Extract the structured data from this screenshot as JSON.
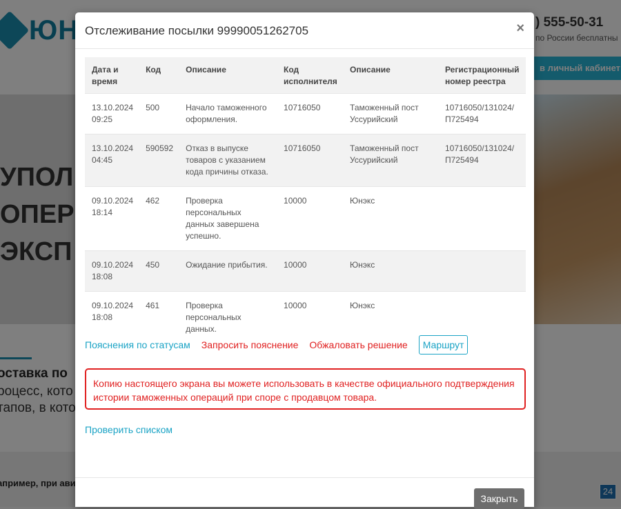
{
  "background": {
    "logo_text": "ЮН",
    "phone": ") 555-50-31",
    "phone_note": "по России бесплатны",
    "cabinet_button": "в личный кабинет",
    "hero_lines": [
      "УПОЛ",
      "ОПЕР",
      "ЭКСП"
    ],
    "subtitle": "оставка по",
    "text_line1": "роцесс, кото",
    "text_line2": "тапов, в кото",
    "footer_text": "апример, при ави",
    "badge": "24"
  },
  "modal": {
    "title": "Отслеживание посылки 99990051262705",
    "close_icon": "×",
    "table": {
      "headers": [
        "Дата и время",
        "Код",
        "Описание",
        "Код исполнителя",
        "Описание",
        "Регистрационный номер реестра"
      ],
      "rows": [
        {
          "datetime": "13.10.2024 09:25",
          "code": "500",
          "description": "Начало таможенного оформления.",
          "executor_code": "10716050",
          "executor": "Таможенный пост Уссурийский",
          "registry": "10716050/131024/ П725494"
        },
        {
          "datetime": "13.10.2024 04:45",
          "code": "590592",
          "description": "Отказ в выпуске товаров с указанием кода причины отказа.",
          "executor_code": "10716050",
          "executor": "Таможенный пост Уссурийский",
          "registry": "10716050/131024/ П725494"
        },
        {
          "datetime": "09.10.2024 18:14",
          "code": "462",
          "description": "Проверка персональных данных завершена успешно.",
          "executor_code": "10000",
          "executor": "Юнэкс",
          "registry": ""
        },
        {
          "datetime": "09.10.2024 18:08",
          "code": "450",
          "description": "Ожидание прибытия.",
          "executor_code": "10000",
          "executor": "Юнэкс",
          "registry": ""
        },
        {
          "datetime": "09.10.2024 18:08",
          "code": "461",
          "description": "Проверка персональных данных.",
          "executor_code": "10000",
          "executor": "Юнэкс",
          "registry": ""
        }
      ]
    },
    "links": {
      "status_help": "Пояснения по статусам",
      "request_explanation": "Запросить пояснение",
      "appeal": "Обжаловать решение",
      "route": "Маршрут"
    },
    "alert": "Копию настоящего экрана вы можете использовать в качестве официального подтверждения истории таможенных операций при споре с продавцом товара.",
    "check_list": "Проверить списком",
    "close_button": "Закрыть"
  },
  "colors": {
    "accent": "#1aa3c5",
    "danger": "#e02020",
    "close_button_bg": "#6d6d6d"
  }
}
